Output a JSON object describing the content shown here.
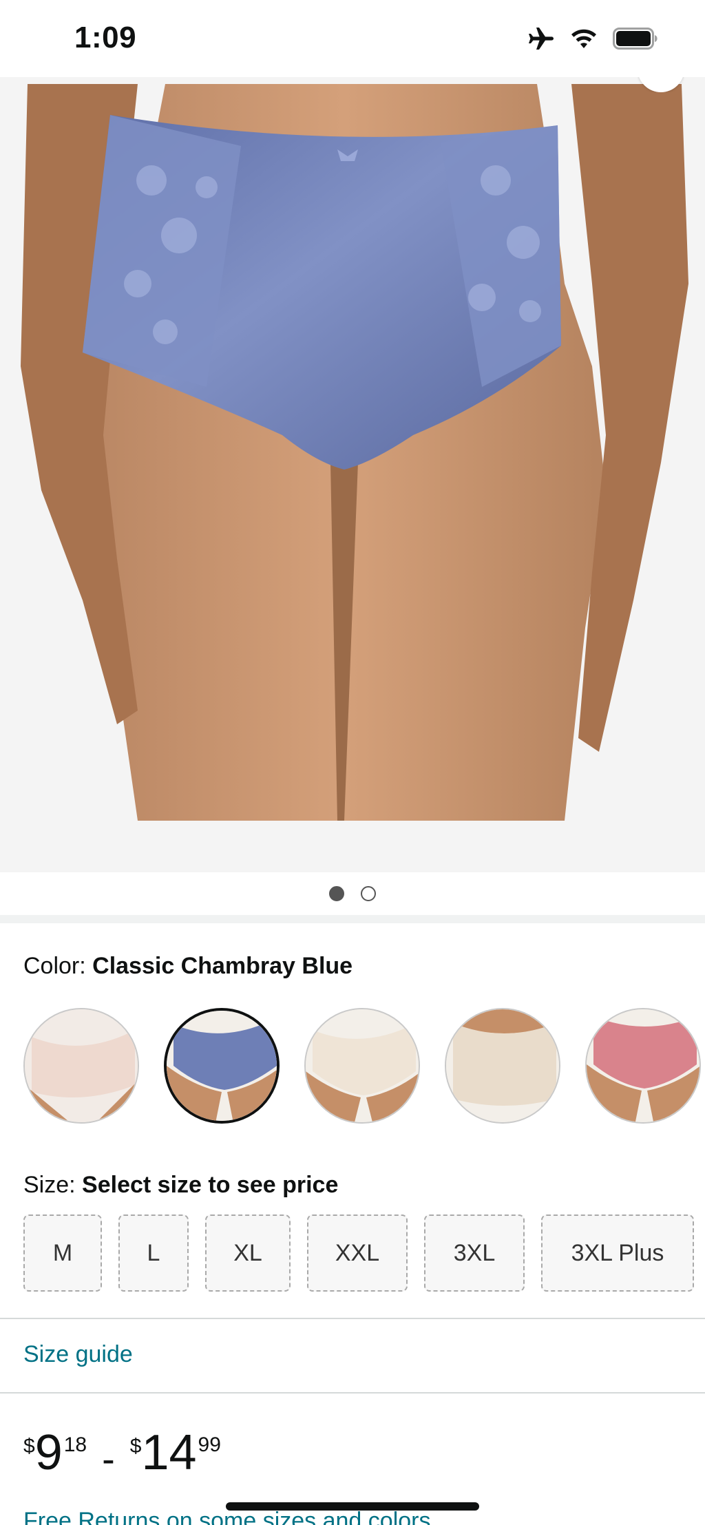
{
  "status_bar": {
    "time": "1:09",
    "icons": [
      "airplane-icon",
      "wifi-icon",
      "battery-icon"
    ]
  },
  "product_image": {
    "description_icon": "product-photo",
    "pager": {
      "count": 2,
      "active_index": 0
    }
  },
  "color": {
    "label": "Color: ",
    "selected": "Classic Chambray Blue",
    "swatch_colors": [
      "#eed9cf",
      "#6e7fb6",
      "#efe4d6",
      "#e9dccb",
      "#d9838c"
    ],
    "selected_index": 1
  },
  "size": {
    "label": "Size: ",
    "prompt": "Select size to see price",
    "options": [
      "M",
      "L",
      "XL",
      "XXL",
      "3XL",
      "3XL Plus"
    ]
  },
  "size_guide": "Size guide",
  "price": {
    "low": {
      "symbol": "$",
      "whole": "9",
      "fraction": "18"
    },
    "separator": "-",
    "high": {
      "symbol": "$",
      "whole": "14",
      "fraction": "99"
    }
  },
  "free_returns": "Free Returns on some sizes and colors",
  "colors": {
    "link": "#007185",
    "text": "#0f1111",
    "product": "#6d7db3"
  }
}
